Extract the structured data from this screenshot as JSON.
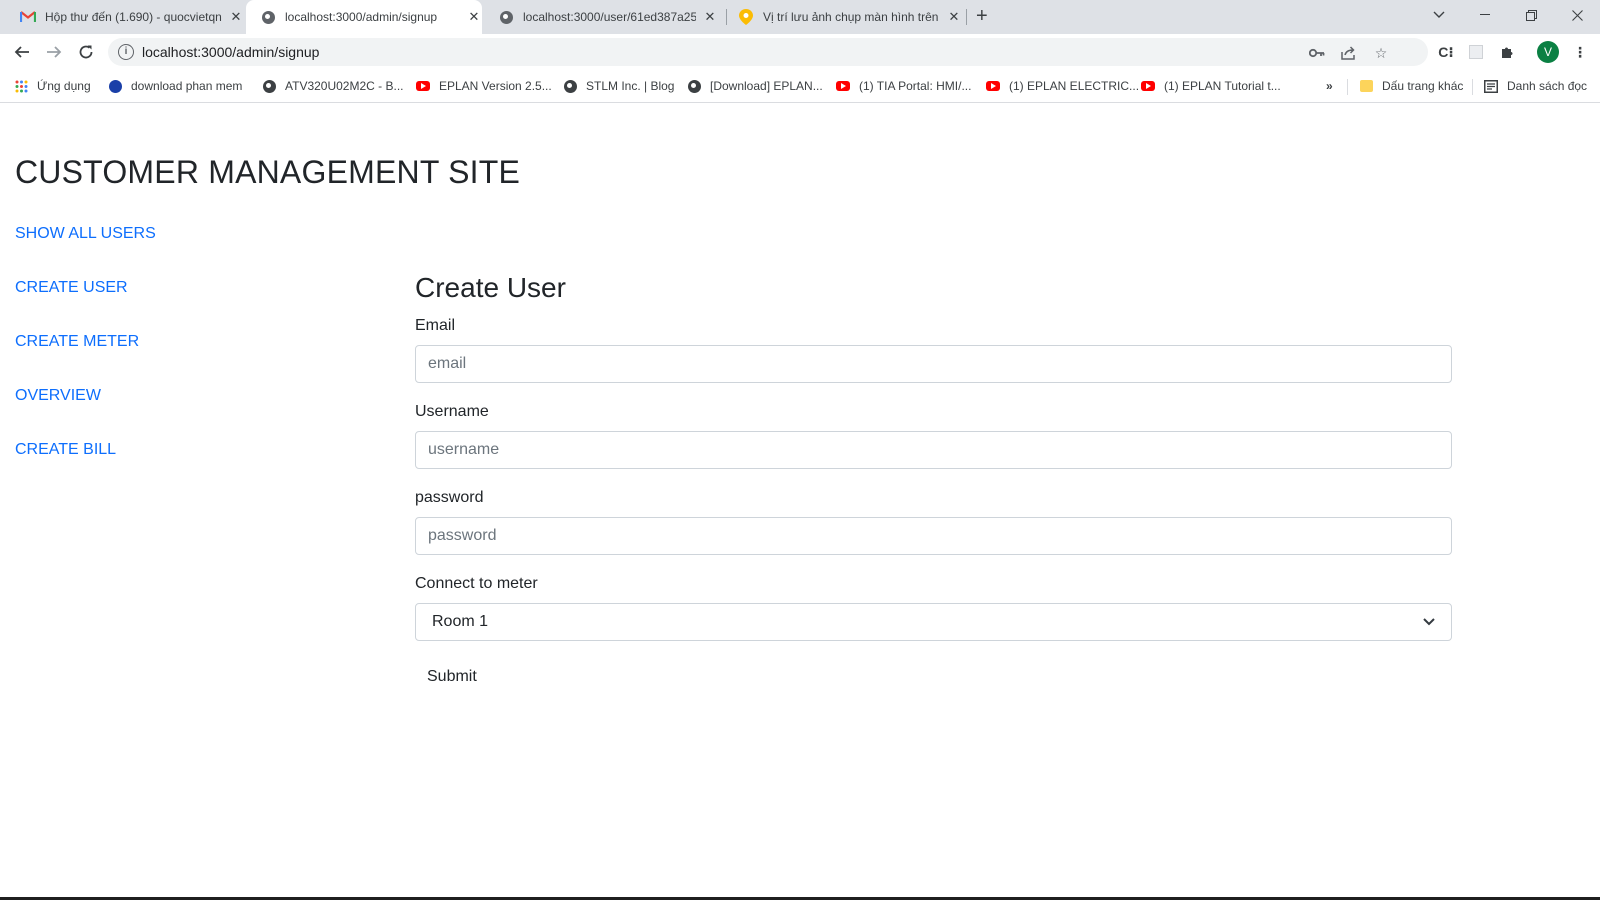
{
  "browser": {
    "tabs": [
      {
        "title": "Hộp thư đến (1.690) - quocvietqn",
        "icon": "gmail-icon"
      },
      {
        "title": "localhost:3000/admin/signup",
        "icon": "globe-icon"
      },
      {
        "title": "localhost:3000/user/61ed387a25",
        "icon": "globe-icon"
      },
      {
        "title": "Vị trí lưu ảnh chụp màn hình trên",
        "icon": "maps-pin-icon"
      }
    ],
    "url": "localhost:3000/admin/signup",
    "profile_initial": "V",
    "bookmarks": [
      {
        "label": "Ứng dụng",
        "icon": "apps-grid-icon"
      },
      {
        "label": "download phan mem",
        "icon": "circle-logo-icon"
      },
      {
        "label": "ATV320U02M2C - B...",
        "icon": "globe-icon"
      },
      {
        "label": "EPLAN Version 2.5...",
        "icon": "youtube-icon"
      },
      {
        "label": "STLM Inc. | Blog",
        "icon": "globe-icon"
      },
      {
        "label": "[Download] EPLAN...",
        "icon": "globe-icon"
      },
      {
        "label": "(1) TIA Portal: HMI/...",
        "icon": "youtube-icon"
      },
      {
        "label": "(1) EPLAN ELECTRIC...",
        "icon": "youtube-icon"
      },
      {
        "label": "(1) EPLAN Tutorial t...",
        "icon": "youtube-icon"
      },
      {
        "label": "Dấu trang khác",
        "icon": "folder-icon"
      },
      {
        "label": "Danh sách đọc",
        "icon": "reading-list-icon"
      }
    ],
    "more_bookmarks": "»"
  },
  "page": {
    "site_title": "CUSTOMER MANAGEMENT SITE",
    "nav": [
      "SHOW ALL USERS",
      "CREATE USER",
      "CREATE METER",
      "OVERVIEW",
      "CREATE BILL"
    ],
    "form": {
      "title": "Create User",
      "email_label": "Email",
      "email_placeholder": "email",
      "username_label": "Username",
      "username_placeholder": "username",
      "password_label": "password",
      "password_placeholder": "password",
      "meter_label": "Connect to meter",
      "meter_selected": "Room 1",
      "submit_label": "Submit"
    }
  },
  "colors": {
    "link": "#0d6efd",
    "text": "#212529",
    "tabstrip": "#dee1e6",
    "avatar": "#0b8043"
  }
}
